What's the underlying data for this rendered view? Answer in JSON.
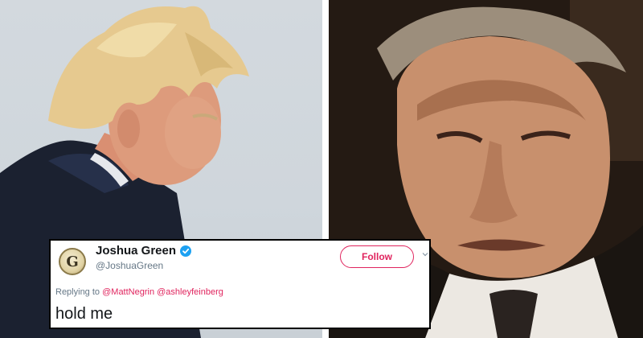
{
  "tweet": {
    "display_name": "Joshua Green",
    "handle": "@JoshuaGreen",
    "avatar_letter": "G",
    "verified": true,
    "follow_label": "Follow",
    "reply_prefix": "Replying to",
    "reply_mentions": [
      "@MattNegrin",
      "@ashleyfeinberg"
    ],
    "text": "hold me"
  },
  "photos": {
    "left": "man-with-windswept-hair-photo",
    "right": "film-character-close-up-photo"
  },
  "colors": {
    "accent": "#e0245e",
    "verified_badge": "#1da1f2",
    "muted_text": "#657786"
  }
}
